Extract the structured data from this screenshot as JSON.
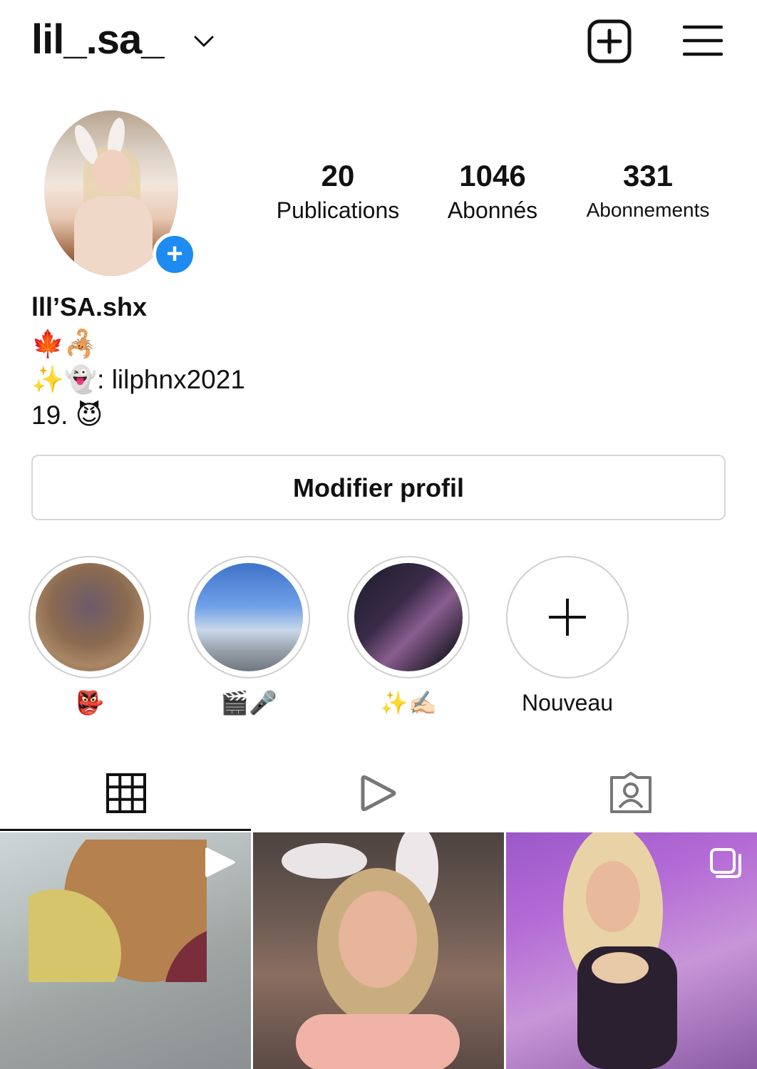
{
  "header": {
    "username": "lil_.sa_",
    "icons": [
      "chevron-down-icon",
      "new-post-icon",
      "menu-icon"
    ]
  },
  "profile": {
    "avatar_badge": "+",
    "stats": {
      "posts_count": "20",
      "posts_label": "Publications",
      "followers_count": "1046",
      "followers_label": "Abonnés",
      "following_count": "331",
      "following_label": "Abonnements"
    },
    "display_name": "lll’SA.shx",
    "bio": {
      "line1": "🍁🦂",
      "line2": "✨👻: lilphnx2021",
      "line3": "19. 😈"
    },
    "edit_button": "Modifier profil"
  },
  "highlights": [
    {
      "label": "👺"
    },
    {
      "label": "🎬🎤"
    },
    {
      "label": "✨✍🏻"
    },
    {
      "label": "Nouveau"
    }
  ],
  "tabs": [
    "grid-icon",
    "reels-icon",
    "tagged-icon"
  ],
  "posts": [
    {
      "type": "reel"
    },
    {
      "type": "photo"
    },
    {
      "type": "carousel"
    }
  ]
}
